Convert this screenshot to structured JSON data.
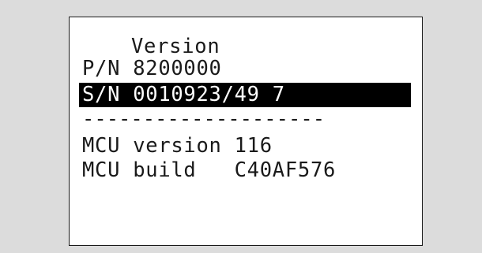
{
  "screen": {
    "title": "Version",
    "part_number_row": "P/N 8200000",
    "serial_number_row": "S/N 0010923/49 7",
    "divider": "--------------------",
    "mcu_version_row": "MCU version 116",
    "mcu_build_row": "MCU build   C40AF576"
  },
  "colors": {
    "background": "#dcdcdc",
    "screen": "#ffffff",
    "text": "#1a1a1a",
    "highlight_bg": "#000000",
    "highlight_text": "#ffffff"
  }
}
